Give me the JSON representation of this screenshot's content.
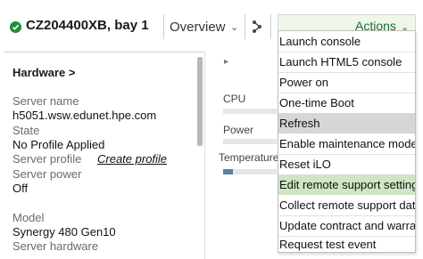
{
  "header": {
    "server_name": "CZ204400XB, bay 1",
    "view_label": "Overview",
    "actions_label": "Actions"
  },
  "hardware": {
    "title": "Hardware >",
    "fields": [
      {
        "label": "Server name",
        "value": "h5051.wsw.edunet.hpe.com"
      },
      {
        "label": "State",
        "value": "No Profile Applied"
      },
      {
        "label": "Server profile",
        "link": "Create profile"
      },
      {
        "label": "Server power",
        "value": "Off"
      },
      {
        "label": "Model",
        "value": "Synergy 480 Gen10"
      },
      {
        "label": "Server hardware"
      }
    ]
  },
  "utilization": {
    "cpu_label": "CPU",
    "power_label": "Power",
    "temperature_label": "Temperature"
  },
  "actions_menu": {
    "items": [
      {
        "label": "Launch console"
      },
      {
        "label": "Launch HTML5 console"
      },
      {
        "label": "Power on"
      },
      {
        "label": "One-time Boot"
      },
      {
        "label": "Refresh",
        "state": "hover"
      },
      {
        "label": "Enable maintenance mode"
      },
      {
        "label": "Reset iLO"
      },
      {
        "label": "Edit remote support settings",
        "state": "highlighted"
      },
      {
        "label": "Collect remote support data"
      },
      {
        "label": "Update contract and warranty"
      },
      {
        "label": "Request test event"
      }
    ]
  },
  "colors": {
    "status_ok": "#1e8c3a",
    "actions_bg": "#eef7ea",
    "menu_hover": "#d6d6d6",
    "menu_highlight": "#cfe5c4",
    "bar_fill": "#5b7fa6"
  }
}
